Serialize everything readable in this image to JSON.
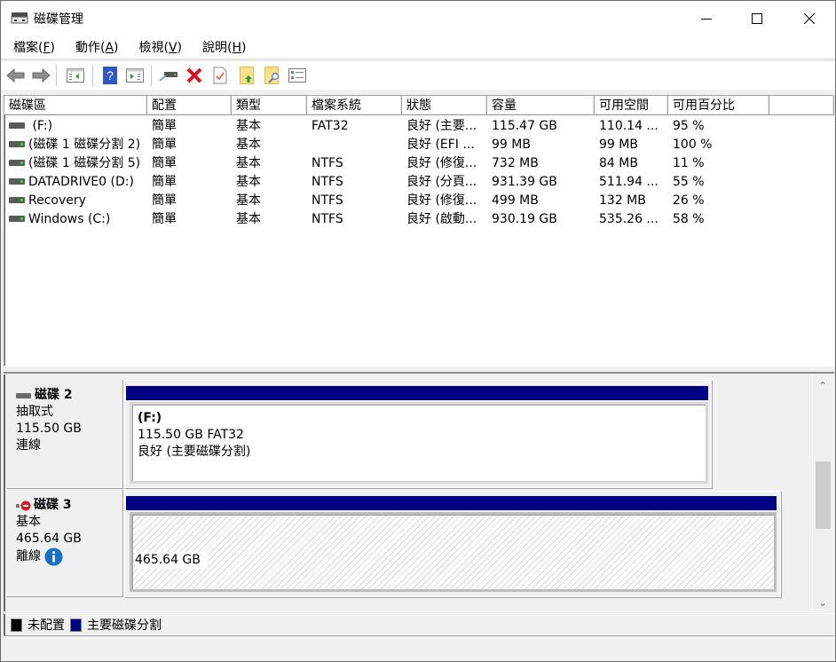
{
  "window": {
    "title": "磁碟管理",
    "icon": "disk-management-icon",
    "controls": {
      "minimize": "minimize-icon",
      "maximize": "maximize-icon",
      "close": "close-icon"
    }
  },
  "menu": [
    {
      "label": "檔案(",
      "key": "F",
      "end": ")"
    },
    {
      "label": "動作(",
      "key": "A",
      "end": ")"
    },
    {
      "label": "檢視(",
      "key": "V",
      "end": ")"
    },
    {
      "label": "說明(",
      "key": "H",
      "end": ")"
    }
  ],
  "toolbar": [
    "back-icon",
    "forward-icon",
    "show-hide-console-tree-icon",
    "help-icon",
    "show-hide-action-pane-icon",
    "connect-drive-icon",
    "delete-icon",
    "properties-icon",
    "open-icon",
    "explore-icon",
    "checklist-icon"
  ],
  "volume_list": {
    "columns": [
      "磁碟區",
      "配置",
      "類型",
      "檔案系統",
      "狀態",
      "容量",
      "可用空間",
      "可用百分比",
      ""
    ],
    "rows": [
      {
        "icon": "volume-icon",
        "name": " (F:)",
        "layout": "簡單",
        "type": "基本",
        "fs": "FAT32",
        "status": "良好 (主要...",
        "capacity": "115.47 GB",
        "free": "110.14 ...",
        "pct": "95 %"
      },
      {
        "icon": "volume-icon",
        "name": "(磁碟 1 磁碟分割 2)",
        "layout": "簡單",
        "type": "基本",
        "fs": "",
        "status": "良好 (EFI ...",
        "capacity": "99 MB",
        "free": "99 MB",
        "pct": "100 %"
      },
      {
        "icon": "volume-icon",
        "name": "(磁碟 1 磁碟分割 5)",
        "layout": "簡單",
        "type": "基本",
        "fs": "NTFS",
        "status": "良好 (修復...",
        "capacity": "732 MB",
        "free": "84 MB",
        "pct": "11 %"
      },
      {
        "icon": "volume-icon",
        "name": "DATADRIVE0 (D:)",
        "layout": "簡單",
        "type": "基本",
        "fs": "NTFS",
        "status": "良好 (分頁...",
        "capacity": "931.39 GB",
        "free": "511.94 ...",
        "pct": "55 %"
      },
      {
        "icon": "volume-icon",
        "name": "Recovery",
        "layout": "簡單",
        "type": "基本",
        "fs": "NTFS",
        "status": "良好 (修復...",
        "capacity": "499 MB",
        "free": "132 MB",
        "pct": "26 %"
      },
      {
        "icon": "volume-icon",
        "name": "Windows (C:)",
        "layout": "簡單",
        "type": "基本",
        "fs": "NTFS",
        "status": "良好 (啟動...",
        "capacity": "930.19 GB",
        "free": "535.26 ...",
        "pct": "58 %"
      }
    ]
  },
  "disks": [
    {
      "title": "磁碟 2",
      "icon": "removable-disk-icon",
      "kind": "抽取式",
      "size": "115.50 GB",
      "state": "連線",
      "partition": {
        "name": " (F:)",
        "size_fs": "115.50 GB FAT32",
        "status": "良好 (主要磁碟分割)"
      }
    },
    {
      "title": "磁碟 3",
      "icon": "offline-disk-icon",
      "kind": "基本",
      "size": "465.64 GB",
      "state": "離線",
      "state_icon": "info-icon",
      "partition": {
        "size": "465.64 GB"
      }
    }
  ],
  "legend": [
    {
      "label": "未配置",
      "color": "#000000"
    },
    {
      "label": "主要磁碟分割",
      "color": "#000082"
    }
  ],
  "colors": {
    "primary_partition": "#000082",
    "unallocated": "#000000"
  }
}
